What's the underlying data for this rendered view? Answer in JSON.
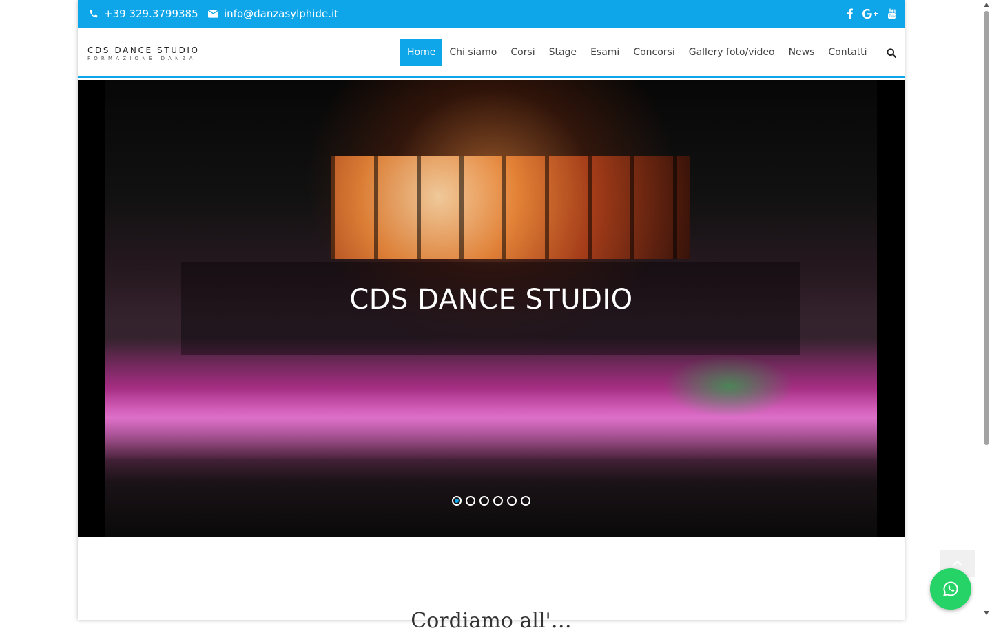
{
  "topbar": {
    "phone": "+39 329.3799385",
    "email": "info@danzasylphide.it",
    "socials": [
      "facebook-icon",
      "google-plus-icon",
      "youtube-icon"
    ],
    "background": "#0ea5e9"
  },
  "header": {
    "logo_line1": "CDS DANCE STUDIO",
    "logo_line2": "FORMAZIONE DANZA",
    "nav": [
      {
        "label": "Home",
        "active": true
      },
      {
        "label": "Chi siamo"
      },
      {
        "label": "Corsi"
      },
      {
        "label": "Stage"
      },
      {
        "label": "Esami"
      },
      {
        "label": "Concorsi"
      },
      {
        "label": "Gallery foto/video"
      },
      {
        "label": "News"
      },
      {
        "label": "Contatti"
      }
    ],
    "search_icon": "search-icon"
  },
  "hero": {
    "caption": "CDS DANCE STUDIO",
    "slides_count": 6,
    "active_slide": 1
  },
  "below": {
    "title_partial": "Cordiamo all'…"
  },
  "colors": {
    "accent": "#0ea5e9",
    "whatsapp": "#25d366"
  }
}
